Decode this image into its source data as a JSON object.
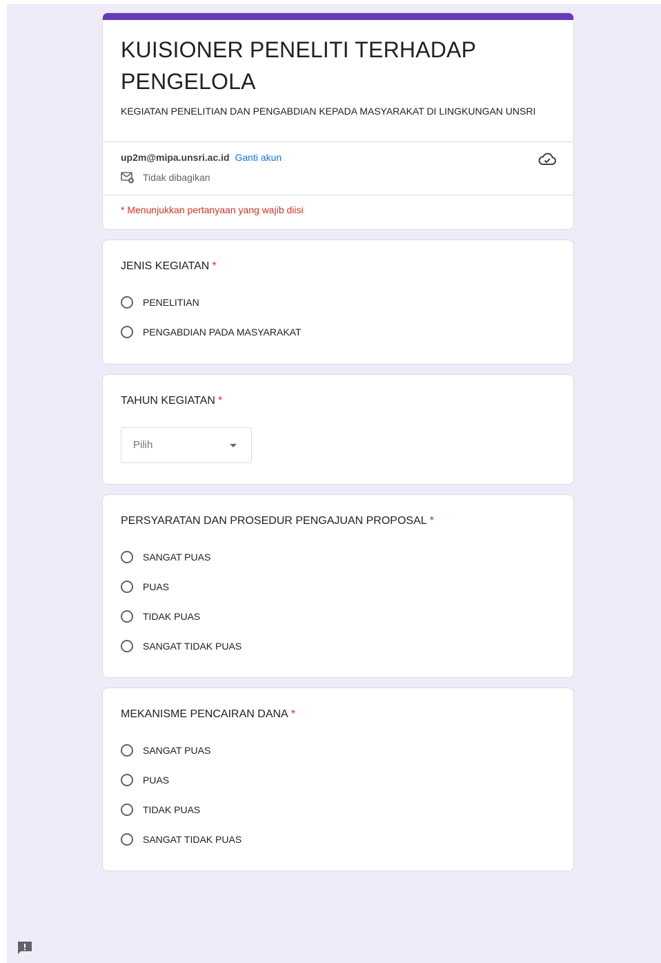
{
  "header": {
    "title": "KUISIONER PENELITI TERHADAP PENGELOLA",
    "description": "KEGIATAN PENELITIAN DAN PENGABDIAN KEPADA MASYARAKAT DI LINGKUNGAN UNSRI",
    "account_email": "up2m@mipa.unsri.ac.id",
    "switch_account_label": "Ganti akun",
    "shared_status": "Tidak dibagikan",
    "required_note": "* Menunjukkan pertanyaan yang wajib diisi",
    "accent_color": "#673ab7"
  },
  "questions": [
    {
      "title": "JENIS KEGIATAN",
      "required": "*",
      "type": "radio",
      "options": [
        "PENELITIAN",
        "PENGABDIAN PADA MASYARAKAT"
      ]
    },
    {
      "title": "TAHUN KEGIATAN",
      "required": "*",
      "type": "dropdown",
      "placeholder": "Pilih"
    },
    {
      "title": "PERSYARATAN DAN PROSEDUR PENGAJUAN PROPOSAL",
      "required": "*",
      "type": "radio",
      "options": [
        "SANGAT PUAS",
        "PUAS",
        "TIDAK PUAS",
        "SANGAT TIDAK PUAS"
      ]
    },
    {
      "title": "MEKANISME PENCAIRAN DANA",
      "required": "*",
      "type": "radio",
      "options": [
        "SANGAT PUAS",
        "PUAS",
        "TIDAK PUAS",
        "SANGAT TIDAK PUAS"
      ]
    }
  ],
  "icons": {
    "cloud": "cloud-check-icon",
    "mail": "mail-not-shared-icon",
    "feedback": "feedback-icon"
  }
}
